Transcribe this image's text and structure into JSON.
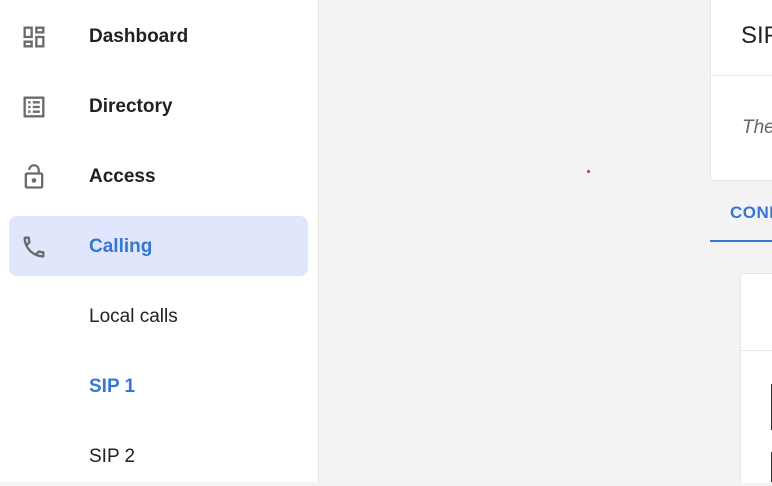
{
  "sidebar": {
    "items": [
      {
        "label": "Dashboard",
        "icon": "dashboard-icon"
      },
      {
        "label": "Directory",
        "icon": "directory-icon"
      },
      {
        "label": "Access",
        "icon": "lock-open-icon"
      },
      {
        "label": "Calling",
        "icon": "phone-icon",
        "active": true
      }
    ],
    "sub_items": [
      {
        "label": "Local calls"
      },
      {
        "label": "SIP 1",
        "active": true
      },
      {
        "label": "SIP 2"
      }
    ]
  },
  "main": {
    "card_title": "SIP",
    "card_description": "The",
    "tab_label": "CONF"
  },
  "colors": {
    "accent": "#3777d4",
    "active_bg": "#e0e7fd",
    "text": "#202124",
    "background": "#f3f3f3"
  }
}
